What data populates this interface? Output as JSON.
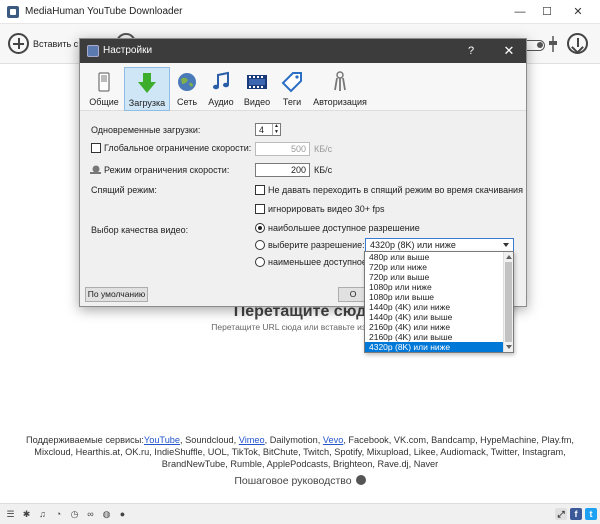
{
  "window": {
    "title": "MediaHuman YouTube Downloader",
    "minimize": "—",
    "maximize": "☐",
    "close": "✕"
  },
  "toolbar": {
    "add_label": "Вставить с"
  },
  "drop_area": {
    "title": "Перетащите сюд",
    "hint": "Перетащите URL сюда или вставьте из буфе"
  },
  "services": {
    "prefix": "Поддерживаемые сервисы:",
    "youtube": "YouTube",
    "part1": ", Soundcloud, ",
    "vimeo": "Vimeo",
    "part2": ", Dailymotion, ",
    "vevo": "Vevo",
    "part3": ", Facebook, VK.com, Bandcamp, HypeMachine, Play.fm, Mixcloud, Hearthis.at, OK.ru, IndieShuffle, UOL, TikTok, BitChute, Twitch, Spotify, Mixupload, Likee, Audiomack, Twitter, Instagram, BrandNewTube, Rumble, ApplePodcasts, Brighteon, Rave.dj, Naver"
  },
  "guide": {
    "label": "Пошаговое руководство"
  },
  "dialog": {
    "title": "Настройки",
    "help": "?",
    "close": "✕",
    "tabs": [
      {
        "label": "Общие",
        "icon": "switch-icon"
      },
      {
        "label": "Загрузка",
        "icon": "download-arrow-icon"
      },
      {
        "label": "Сеть",
        "icon": "globe-icon"
      },
      {
        "label": "Аудио",
        "icon": "music-note-icon"
      },
      {
        "label": "Видео",
        "icon": "film-icon"
      },
      {
        "label": "Теги",
        "icon": "tag-icon"
      },
      {
        "label": "Авторизация",
        "icon": "keys-icon"
      }
    ],
    "active_tab": "Загрузка",
    "concurrent_label": "Одновременные загрузки:",
    "concurrent_value": "4",
    "global_limit_label": "Глобальное ограничение скорости:",
    "global_limit_value": "500",
    "global_limit_unit": "КБ/с",
    "limit_mode_label": "Режим ограничения скорости:",
    "limit_mode_value": "200",
    "limit_mode_unit": "КБ/с",
    "sleep_label": "Спящий режим:",
    "sleep_option": "Не давать переходить в спящий режим во время скачивания",
    "ignore_30fps": "игнорировать видео 30+ fps",
    "quality_label": "Выбор качества видео:",
    "quality_best": "наибольшее доступное разрешение",
    "quality_choose": "выберите разрешение:",
    "quality_choose_value": "4320p (8K) или ниже",
    "quality_lowest": "наименьшее доступное р",
    "default_button": "По умолчанию",
    "ok_button": "О"
  },
  "dropdown": {
    "items": [
      "480p или выше",
      "720p или ниже",
      "720p или выше",
      "1080p или ниже",
      "1080p или выше",
      "1440p (4K) или ниже",
      "1440p (4K) или выше",
      "2160p (4K) или ниже",
      "2160p (4K) или выше",
      "4320p (8K) или ниже"
    ],
    "selected": "4320p (8K) или ниже"
  },
  "colors": {
    "accent": "#0078d7",
    "dialog_titlebar": "#3c3c3c",
    "link": "#2255cc",
    "active_tab": "#cfe6f7"
  }
}
